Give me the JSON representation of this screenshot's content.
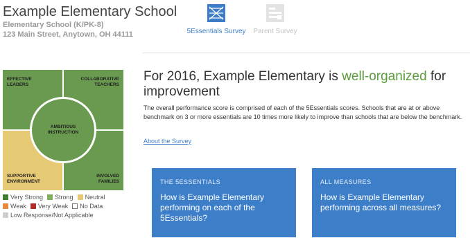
{
  "school": {
    "name": "Example Elementary School",
    "type": "Elementary School (K/PK-8)",
    "address": "123 Main Street, Anytown, OH 44111"
  },
  "tabs": {
    "essentials": {
      "label": "5Essentials Survey",
      "icon": "survey-grid-icon",
      "color": "#3d7cc9",
      "active": true
    },
    "parent": {
      "label": "Parent Survey",
      "icon": "parent-survey-icon",
      "color": "#c2c2c2",
      "active": false
    }
  },
  "diagram": {
    "effective_leaders": "EFFECTIVE\nLEADERS",
    "collaborative_teachers": "COLLABORATIVE\nTEACHERS",
    "ambitious_instruction": "AMBITIOUS\nINSTRUCTION",
    "supportive_environment": "SUPPORTIVE\nENVIRONMENT",
    "involved_families": "INVOLVED\nFAMILIES",
    "colors": {
      "strong": "#6a9a50",
      "neutral": "#e6c974"
    }
  },
  "legend": {
    "very_strong": {
      "label": "Very Strong",
      "color": "#3f7f2f"
    },
    "strong": {
      "label": "Strong",
      "color": "#7fae5c"
    },
    "neutral": {
      "label": "Neutral",
      "color": "#e6c974"
    },
    "weak": {
      "label": "Weak",
      "color": "#e58a3b"
    },
    "very_weak": {
      "label": "Very Weak",
      "color": "#b22a2a"
    },
    "no_data": {
      "label": "No Data",
      "color": "#ffffff"
    },
    "low_response": {
      "label": "Low Response/Not Applicable",
      "color": "#cfcfcf"
    }
  },
  "headline": {
    "prefix": "For 2016, Example Elementary is ",
    "accent": "well-organized",
    "suffix": " for improvement",
    "accent_color": "#5a9b3c"
  },
  "description": "The overall performance score is comprised of each of the 5Essentials scores. Schools that are at or above benchmark on 3 or more essentials are 10 times more likely to improve than schools that are below the benchmark.",
  "about_link": "About the Survey",
  "cards": [
    {
      "title": "THE 5ESSENTIALS",
      "question": "How is Example Elementary performing on each of the 5Essentials?"
    },
    {
      "title": "ALL MEASURES",
      "question": "How is Example Elementary performing across all measures?"
    }
  ],
  "card_color": "#3d7ec9"
}
